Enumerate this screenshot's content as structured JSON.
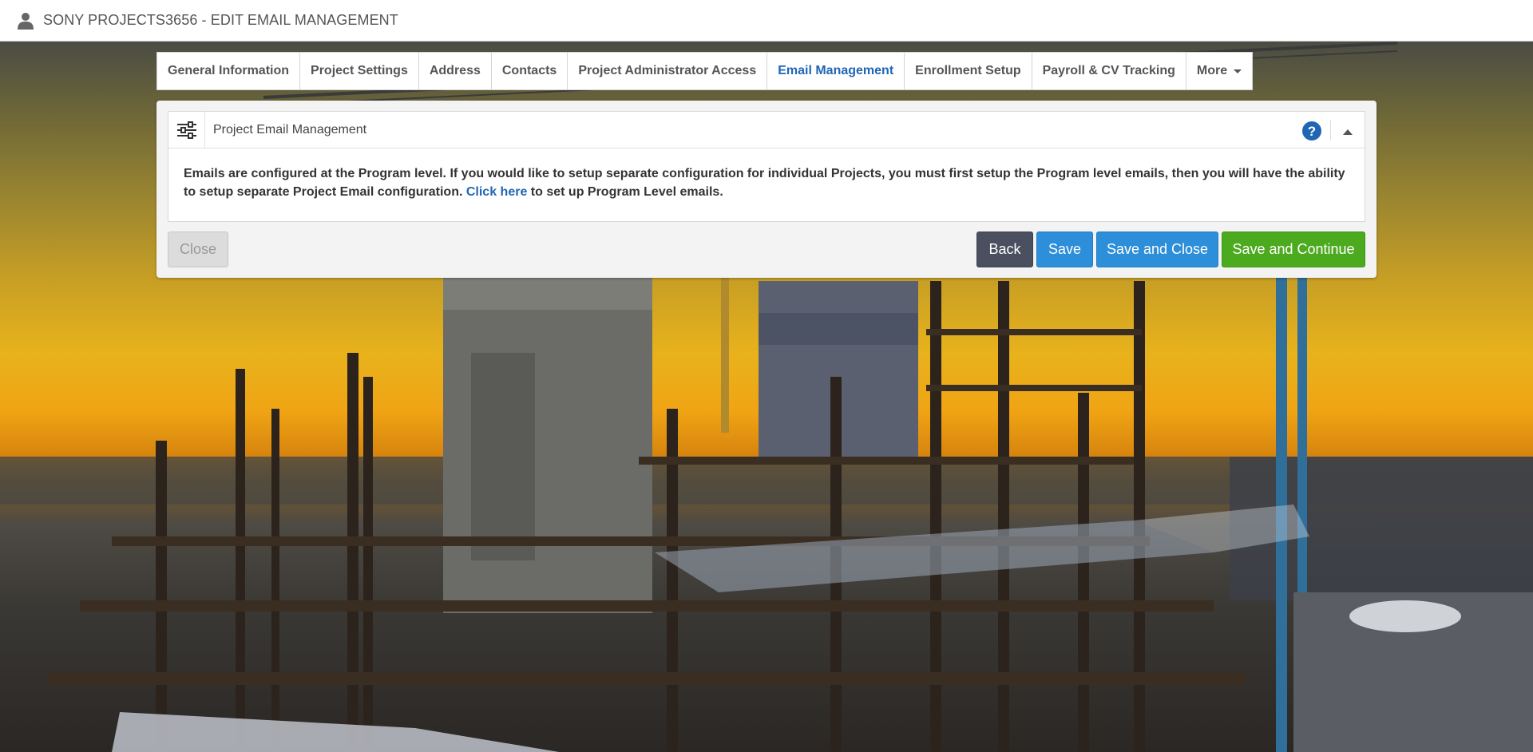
{
  "header": {
    "title": "SONY PROJECTS3656 - EDIT EMAIL MANAGEMENT",
    "user_icon": "user-icon"
  },
  "tabs": [
    {
      "label": "General Information",
      "active": false
    },
    {
      "label": "Project Settings",
      "active": false
    },
    {
      "label": "Address",
      "active": false
    },
    {
      "label": "Contacts",
      "active": false
    },
    {
      "label": "Project Administrator Access",
      "active": false
    },
    {
      "label": "Email Management",
      "active": true
    },
    {
      "label": "Enrollment Setup",
      "active": false
    },
    {
      "label": "Payroll & CV Tracking",
      "active": false
    },
    {
      "label": "More",
      "active": false
    }
  ],
  "panel": {
    "title": "Project Email Management",
    "icons": {
      "settings": "sliders-icon",
      "help": "help-icon",
      "collapse": "collapse-up-icon"
    },
    "message_part1": "Emails are configured at the Program level. If you would like to setup separate configuration for individual Projects, you must first setup the Program level emails, then you will have the ability to setup separate Project Email configuration.",
    "link_text": "Click here",
    "message_part2": "to set up Program Level emails."
  },
  "buttons": {
    "close": "Close",
    "back": "Back",
    "save": "Save",
    "save_and_close": "Save and Close",
    "save_and_continue": "Save and Continue"
  },
  "colors": {
    "active_tab": "#1f66b3",
    "link": "#1f66b3",
    "save": "#2d8ed9",
    "back": "#4a5060",
    "save_continue": "#4caa1f"
  }
}
